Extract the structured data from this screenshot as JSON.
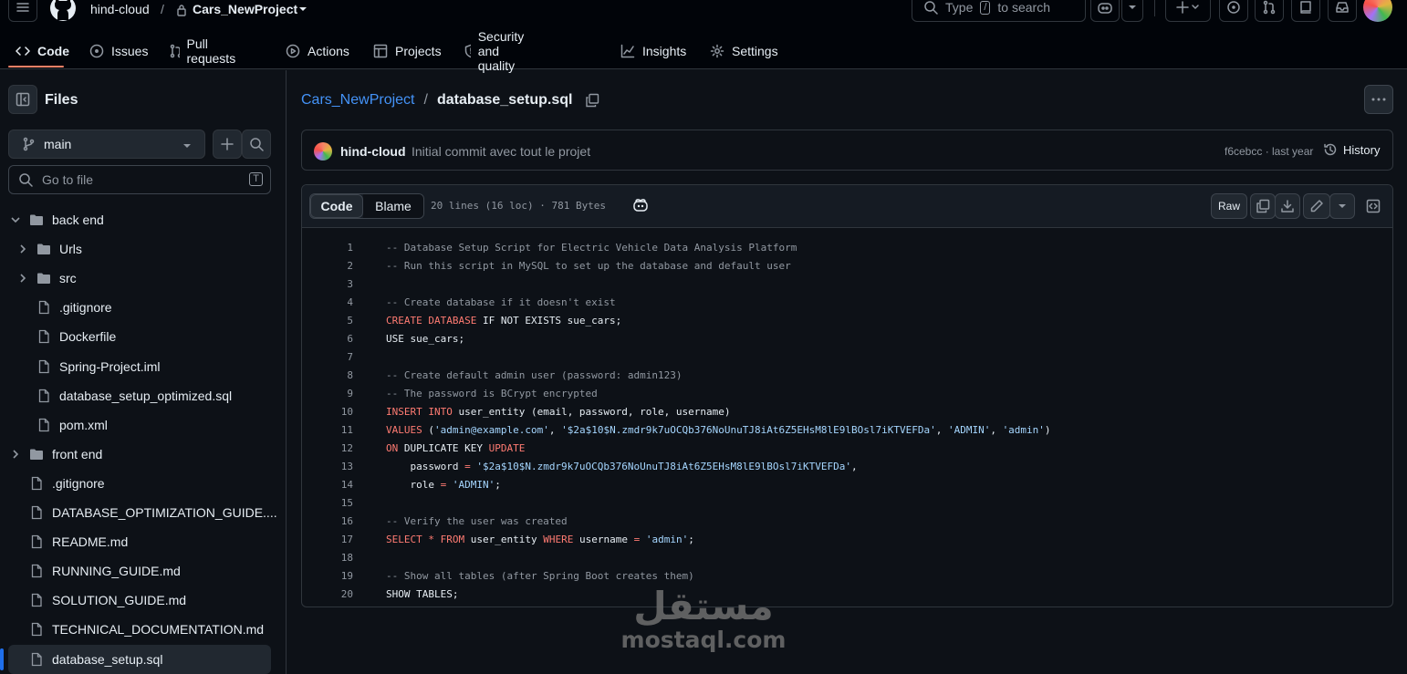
{
  "header": {
    "owner": "hind-cloud",
    "separator": "/",
    "repo": "Cars_NewProject",
    "search_placeholder_prefix": "Type",
    "search_key": "/",
    "search_placeholder_suffix": "to search"
  },
  "tabs": [
    {
      "label": "Code",
      "icon": "code-icon",
      "active": true
    },
    {
      "label": "Issues",
      "icon": "issue-icon"
    },
    {
      "label": "Pull requests",
      "icon": "pull-request-icon"
    },
    {
      "label": "Actions",
      "icon": "play-icon"
    },
    {
      "label": "Projects",
      "icon": "table-icon"
    },
    {
      "label": "Security and quality",
      "icon": "shield-icon"
    },
    {
      "label": "Insights",
      "icon": "graph-icon"
    },
    {
      "label": "Settings",
      "icon": "gear-icon"
    }
  ],
  "sidebar": {
    "title": "Files",
    "branch": "main",
    "goto_placeholder": "Go to file",
    "goto_key": "T",
    "tree": [
      {
        "label": "back end",
        "type": "folder",
        "depth": 0,
        "expanded": true
      },
      {
        "label": "Urls",
        "type": "folder",
        "depth": 1,
        "expanded": false
      },
      {
        "label": "src",
        "type": "folder",
        "depth": 1,
        "expanded": false
      },
      {
        "label": ".gitignore",
        "type": "file",
        "depth": 1
      },
      {
        "label": "Dockerfile",
        "type": "file",
        "depth": 1
      },
      {
        "label": "Spring-Project.iml",
        "type": "file",
        "depth": 1
      },
      {
        "label": "database_setup_optimized.sql",
        "type": "file",
        "depth": 1
      },
      {
        "label": "pom.xml",
        "type": "file",
        "depth": 1
      },
      {
        "label": "front end",
        "type": "folder",
        "depth": 0,
        "expanded": false
      },
      {
        "label": ".gitignore",
        "type": "file",
        "depth": 0
      },
      {
        "label": "DATABASE_OPTIMIZATION_GUIDE....",
        "type": "file",
        "depth": 0
      },
      {
        "label": "README.md",
        "type": "file",
        "depth": 0
      },
      {
        "label": "RUNNING_GUIDE.md",
        "type": "file",
        "depth": 0
      },
      {
        "label": "SOLUTION_GUIDE.md",
        "type": "file",
        "depth": 0
      },
      {
        "label": "TECHNICAL_DOCUMENTATION.md",
        "type": "file",
        "depth": 0
      },
      {
        "label": "database_setup.sql",
        "type": "file",
        "depth": 0,
        "selected": true
      }
    ]
  },
  "file": {
    "repo": "Cars_NewProject",
    "separator": "/",
    "name": "database_setup.sql"
  },
  "commit": {
    "author": "hind-cloud",
    "message": "Initial commit avec tout le projet",
    "sha_time": "f6cebcc · last year",
    "history_label": "History"
  },
  "viewer": {
    "code_tab": "Code",
    "blame_tab": "Blame",
    "meta": "20 lines (16 loc) · 781 Bytes",
    "raw_label": "Raw"
  },
  "code_lines": [
    [
      [
        "c",
        "-- Database Setup Script for Electric Vehicle Data Analysis Platform"
      ]
    ],
    [
      [
        "c",
        "-- Run this script in MySQL to set up the database and default user"
      ]
    ],
    [],
    [
      [
        "c",
        "-- Create database if it doesn't exist"
      ]
    ],
    [
      [
        "k",
        "CREATE DATABASE"
      ],
      [
        "t",
        " IF NOT EXISTS sue_cars;"
      ]
    ],
    [
      [
        "t",
        "USE sue_cars;"
      ]
    ],
    [],
    [
      [
        "c",
        "-- Create default admin user (password: admin123)"
      ]
    ],
    [
      [
        "c",
        "-- The password is BCrypt encrypted"
      ]
    ],
    [
      [
        "k",
        "INSERT INTO"
      ],
      [
        "t",
        " user_entity (email, password, role, username)"
      ]
    ],
    [
      [
        "k",
        "VALUES"
      ],
      [
        "t",
        " ("
      ],
      [
        "s",
        "'admin@example.com'"
      ],
      [
        "t",
        ", "
      ],
      [
        "s",
        "'$2a$10$N.zmdr9k7uOCQb376NoUnuTJ8iAt6Z5EHsM8lE9lBOsl7iKTVEFDa'"
      ],
      [
        "t",
        ", "
      ],
      [
        "s",
        "'ADMIN'"
      ],
      [
        "t",
        ", "
      ],
      [
        "s",
        "'admin'"
      ],
      [
        "t",
        ")"
      ]
    ],
    [
      [
        "k",
        "ON"
      ],
      [
        "t",
        " DUPLICATE KEY "
      ],
      [
        "k",
        "UPDATE"
      ]
    ],
    [
      [
        "t",
        "    password "
      ],
      [
        "k",
        "="
      ],
      [
        "t",
        " "
      ],
      [
        "s",
        "'$2a$10$N.zmdr9k7uOCQb376NoUnuTJ8iAt6Z5EHsM8lE9lBOsl7iKTVEFDa'"
      ],
      [
        "t",
        ","
      ]
    ],
    [
      [
        "t",
        "    role "
      ],
      [
        "k",
        "="
      ],
      [
        "t",
        " "
      ],
      [
        "s",
        "'ADMIN'"
      ],
      [
        "t",
        ";"
      ]
    ],
    [],
    [
      [
        "c",
        "-- Verify the user was created"
      ]
    ],
    [
      [
        "k",
        "SELECT"
      ],
      [
        "t",
        " "
      ],
      [
        "k",
        "*"
      ],
      [
        "t",
        " "
      ],
      [
        "k",
        "FROM"
      ],
      [
        "t",
        " user_entity "
      ],
      [
        "k",
        "WHERE"
      ],
      [
        "t",
        " username "
      ],
      [
        "k",
        "="
      ],
      [
        "t",
        " "
      ],
      [
        "s",
        "'admin'"
      ],
      [
        "t",
        ";"
      ]
    ],
    [],
    [
      [
        "c",
        "-- Show all tables (after Spring Boot creates them)"
      ]
    ],
    [
      [
        "t",
        "SHOW TABLES;"
      ]
    ]
  ],
  "watermark": {
    "arabic": "مستقل",
    "latin": "mostaql.com"
  }
}
